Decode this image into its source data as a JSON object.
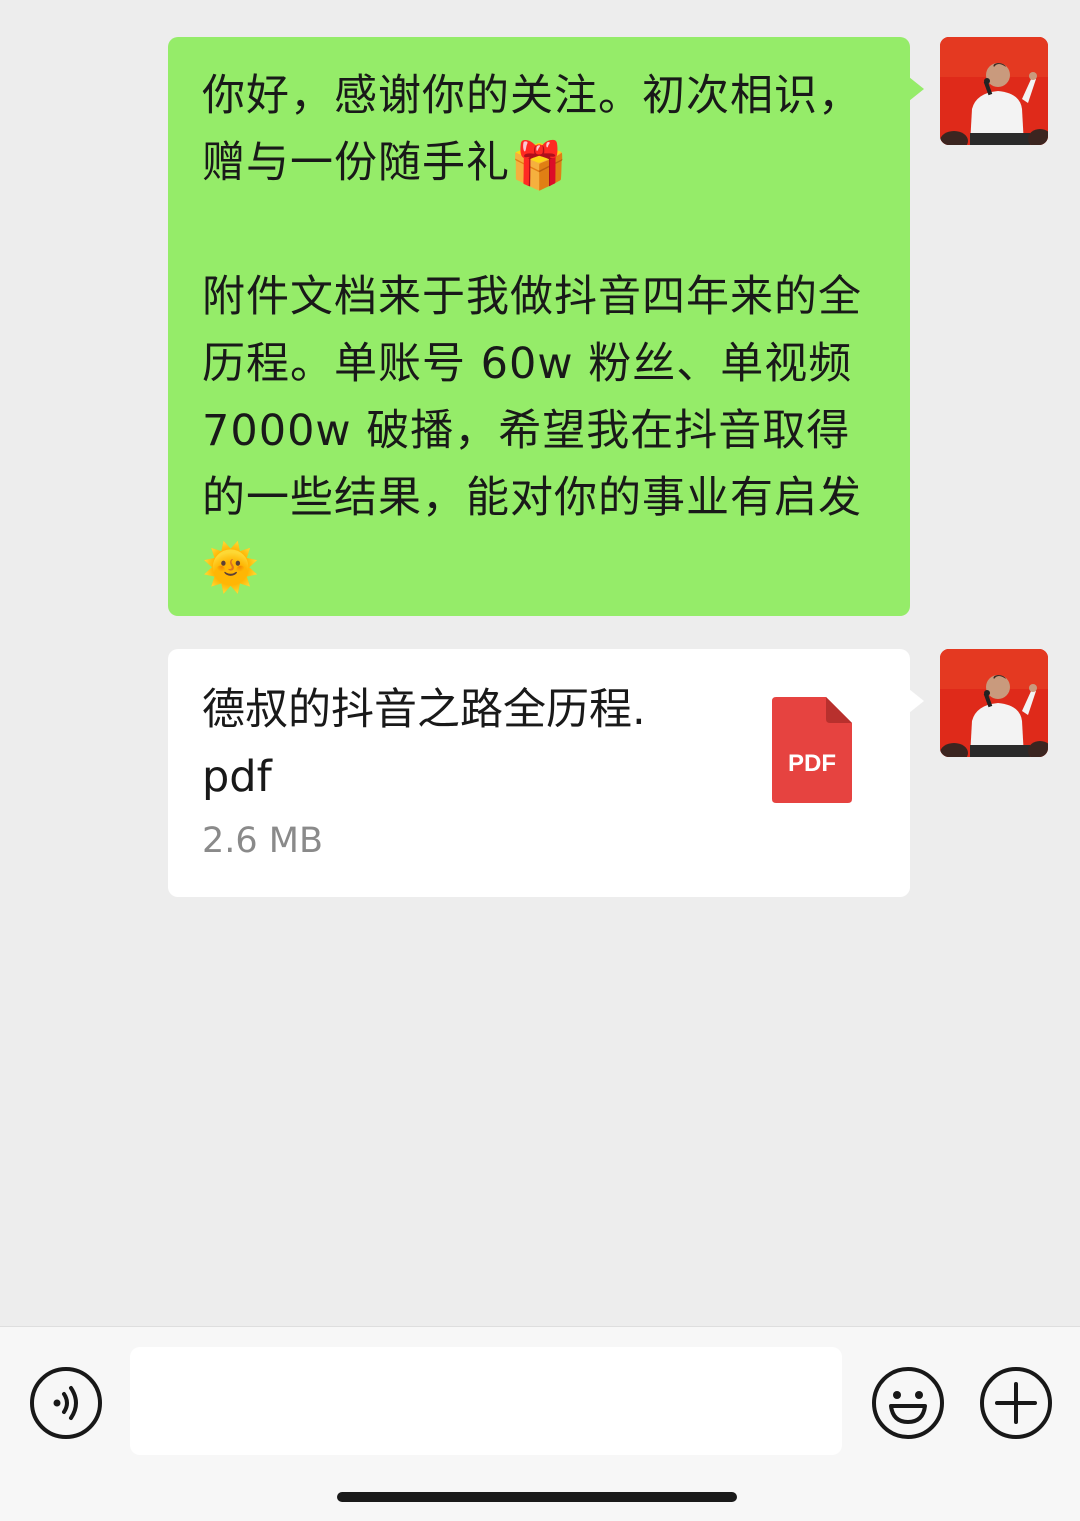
{
  "messages": [
    {
      "type": "text",
      "lines": [
        "你好，感谢你的关注。初次相识，",
        "赠与一份随手礼",
        "",
        "附件文档来于我做抖音四年来的全",
        "历程。单账号 60w 粉丝、单视频",
        "7000w 破播，希望我在抖音取得",
        "的一些结果，能对你的事业有启发",
        ""
      ],
      "gift_emoji": "🎁",
      "sun_emoji": "🌞"
    },
    {
      "type": "file",
      "file_name_line1": "德叔的抖音之路全历程.",
      "file_name_line2": "pdf",
      "file_size": "2.6 MB",
      "file_type_label": "PDF"
    }
  ],
  "colors": {
    "sent_bubble": "#95ec69",
    "file_bubble": "#ffffff",
    "background": "#ededed",
    "pdf_red": "#e64340"
  },
  "input_bar": {
    "left_icon": "voice-icon",
    "emoji_icon": "emoji-icon",
    "plus_icon": "plus-icon",
    "input_value": ""
  }
}
